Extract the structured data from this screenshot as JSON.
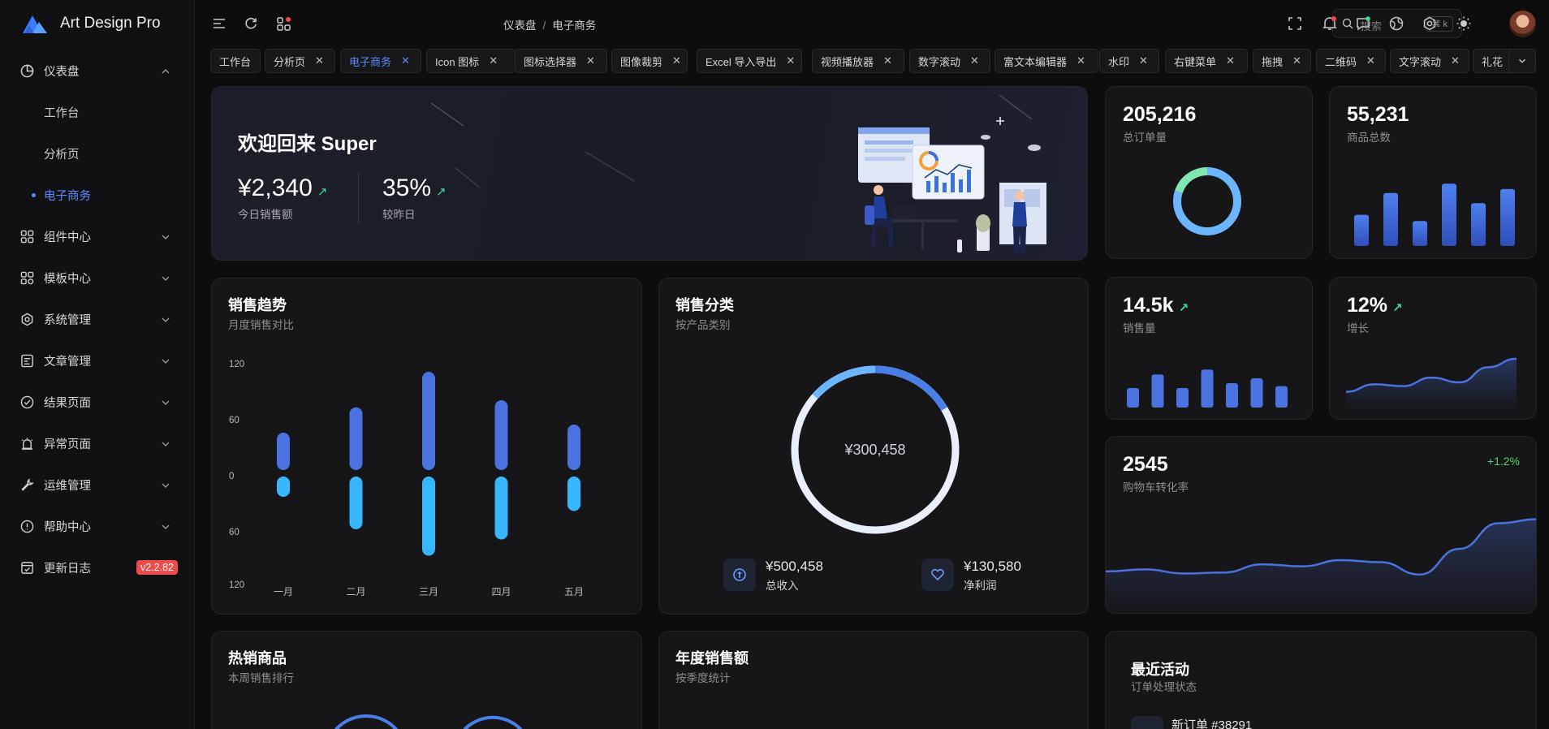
{
  "app": {
    "name": "Art Design Pro"
  },
  "sidebar": {
    "items": [
      {
        "label": "仪表盘",
        "icon": "dashboard-icon"
      },
      {
        "label": "工作台"
      },
      {
        "label": "分析页"
      },
      {
        "label": "电子商务"
      },
      {
        "label": "组件中心",
        "icon": "components-icon"
      },
      {
        "label": "模板中心",
        "icon": "template-icon"
      },
      {
        "label": "系统管理",
        "icon": "settings-icon"
      },
      {
        "label": "文章管理",
        "icon": "article-icon"
      },
      {
        "label": "结果页面",
        "icon": "check-circle-icon"
      },
      {
        "label": "异常页面",
        "icon": "alarm-icon"
      },
      {
        "label": "运维管理",
        "icon": "wrench-icon"
      },
      {
        "label": "帮助中心",
        "icon": "info-icon"
      },
      {
        "label": "更新日志",
        "icon": "changelog-icon",
        "badge": "v2.2.82"
      }
    ]
  },
  "header": {
    "breadcrumb": [
      "仪表盘",
      "电子商务"
    ],
    "search_placeholder": "搜索",
    "shortcut": "⌘ k"
  },
  "tabs": [
    {
      "label": "工作台"
    },
    {
      "label": "分析页"
    },
    {
      "label": "电子商务",
      "active": true
    },
    {
      "label": "Icon 图标"
    },
    {
      "label": "图标选择器"
    },
    {
      "label": "图像裁剪"
    },
    {
      "label": "Excel 导入导出"
    },
    {
      "label": "视频播放器"
    },
    {
      "label": "数字滚动"
    },
    {
      "label": "富文本编辑器"
    },
    {
      "label": "水印"
    },
    {
      "label": "右键菜单"
    },
    {
      "label": "拖拽"
    },
    {
      "label": "二维码"
    },
    {
      "label": "文字滚动"
    },
    {
      "label": "礼花"
    }
  ],
  "welcome": {
    "title": "欢迎回来 Super",
    "sales_value": "¥2,340",
    "sales_label": "今日销售额",
    "growth_value": "35%",
    "growth_label": "较昨日"
  },
  "stats": {
    "orders_value": "205,216",
    "orders_label": "总订单量",
    "products_value": "55,231",
    "products_label": "商品总数",
    "sales_value": "14.5k",
    "sales_label": "销售量",
    "growth_value": "12%",
    "growth_label": "增长",
    "conversion_value": "2545",
    "conversion_label": "购物车转化率",
    "conversion_change": "+1.2%"
  },
  "trend": {
    "title": "销售趋势",
    "subtitle": "月度销售对比"
  },
  "category": {
    "title": "销售分类",
    "subtitle": "按产品类别",
    "center": "¥300,458",
    "revenue_value": "¥500,458",
    "revenue_label": "总收入",
    "profit_value": "¥130,580",
    "profit_label": "净利润"
  },
  "hot": {
    "title": "热销商品",
    "subtitle": "本周销售排行"
  },
  "annual": {
    "title": "年度销售额",
    "subtitle": "按季度统计"
  },
  "activity": {
    "title": "最近活动",
    "subtitle": "订单处理状态",
    "first_item": "新订单 #38291"
  },
  "colors": {
    "accent": "#5b8cff",
    "bar": "#4a72e0",
    "bar_light": "#38b6ff",
    "green": "#3ddc97",
    "badge": "#f04b4b"
  },
  "chart_data": [
    {
      "type": "bar",
      "title": "销售趋势",
      "categories": [
        "一月",
        "二月",
        "三月",
        "四月",
        "五月"
      ],
      "series": [
        {
          "values": [
            40,
            65,
            100,
            72,
            48
          ]
        },
        {
          "values": [
            -20,
            -52,
            -78,
            -62,
            -34
          ]
        }
      ],
      "yticks": [
        "120",
        "60",
        "0",
        "60",
        "120"
      ],
      "ylim": [
        -120,
        120
      ]
    },
    {
      "type": "pie",
      "title": "销售分类",
      "values": [
        30,
        70
      ]
    },
    {
      "type": "bar",
      "values": [
        40,
        68,
        32,
        80,
        55,
        73
      ]
    },
    {
      "type": "bar",
      "values": [
        40,
        68,
        40,
        78,
        50,
        60,
        44
      ]
    },
    {
      "type": "pie",
      "values": [
        80,
        20
      ]
    },
    {
      "type": "area",
      "values": [
        20,
        28,
        26,
        35,
        30,
        46,
        55
      ]
    },
    {
      "type": "area",
      "values": [
        42,
        44,
        40,
        41,
        49,
        47,
        53,
        51,
        39,
        64,
        89,
        93
      ]
    }
  ]
}
